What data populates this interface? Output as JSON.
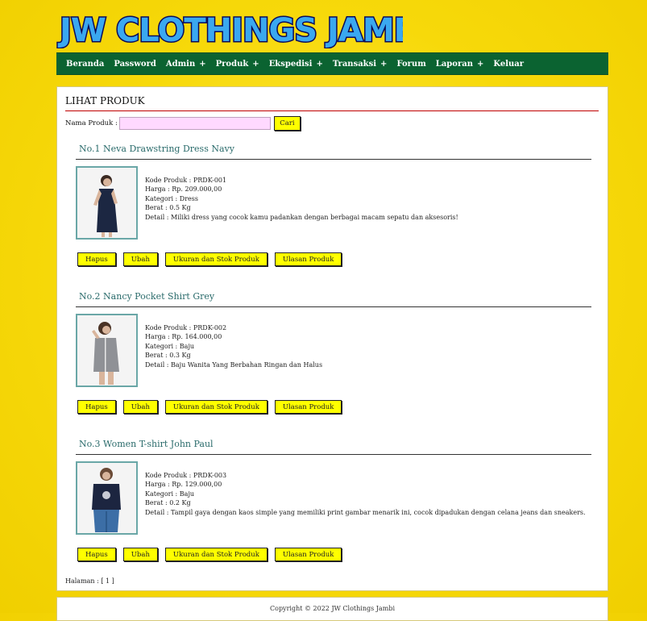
{
  "site": {
    "logo_text": "JW CLOTHINGS JAMBI"
  },
  "nav": [
    {
      "label": "Beranda",
      "has_submenu": false
    },
    {
      "label": "Password",
      "has_submenu": false
    },
    {
      "label": "Admin",
      "has_submenu": true
    },
    {
      "label": "Produk",
      "has_submenu": true
    },
    {
      "label": "Ekspedisi",
      "has_submenu": true
    },
    {
      "label": "Transaksi",
      "has_submenu": true
    },
    {
      "label": "Forum",
      "has_submenu": false
    },
    {
      "label": "Laporan",
      "has_submenu": true
    },
    {
      "label": "Keluar",
      "has_submenu": false
    }
  ],
  "nav_plus": "+",
  "page": {
    "title": "LIHAT PRODUK",
    "search_label": "Nama Produk :",
    "search_value": "",
    "search_button": "Cari"
  },
  "products": [
    {
      "title": "No.1 Neva Drawstring Dress Navy",
      "kode": "Kode Produk : PRDK-001",
      "harga": "Harga : Rp. 209.000,00",
      "kategori": "Kategori : Dress",
      "berat": "Berat : 0.5 Kg",
      "detail": "Detail : Miliki dress yang cocok kamu padankan dengan berbagai macam sepatu dan aksesoris!"
    },
    {
      "title": "No.2 Nancy Pocket Shirt Grey",
      "kode": "Kode Produk : PRDK-002",
      "harga": "Harga : Rp. 164.000,00",
      "kategori": "Kategori : Baju",
      "berat": "Berat : 0.3 Kg",
      "detail": "Detail : Baju Wanita Yang Berbahan Ringan dan Halus"
    },
    {
      "title": "No.3 Women T-shirt John Paul",
      "kode": "Kode Produk : PRDK-003",
      "harga": "Harga : Rp. 129.000,00",
      "kategori": "Kategori : Baju",
      "berat": "Berat : 0.2 Kg",
      "detail": "Detail : Tampil gaya dengan kaos simple yang memiliki print gambar menarik ini, cocok dipadukan dengan celana jeans dan sneakers."
    }
  ],
  "actions": {
    "hapus": "Hapus",
    "ubah": "Ubah",
    "ukuran": "Ukuran dan Stok Produk",
    "ulasan": "Ulasan Produk"
  },
  "pager": "Halaman : [ 1 ]",
  "footer": "Copyright © 2022 JW Clothings Jambi",
  "colors": {
    "background": "#f7d90a",
    "nav": "#0b6331",
    "button": "#ffff00",
    "search_input": "#ffd9ff",
    "logo_fill": "#3aa8f0",
    "product_title": "#2a6b6b"
  }
}
